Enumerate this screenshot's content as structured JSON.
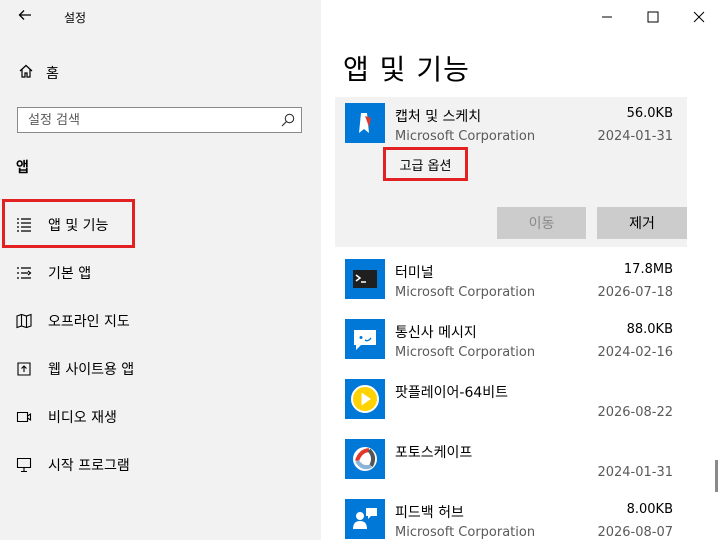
{
  "window": {
    "title": "설정",
    "back_icon": "arrow-left-icon",
    "controls": [
      "minimize-icon",
      "maximize-icon",
      "close-icon"
    ]
  },
  "sidebar": {
    "home_label": "홈",
    "search_placeholder": "설정 검색",
    "section_title": "앱",
    "items": [
      {
        "label": "앱 및 기능",
        "icon": "list-icon",
        "selected": true
      },
      {
        "label": "기본 앱",
        "icon": "default-apps-icon"
      },
      {
        "label": "오프라인 지도",
        "icon": "map-icon"
      },
      {
        "label": "웹 사이트용 앱",
        "icon": "open-in-app-icon"
      },
      {
        "label": "비디오 재생",
        "icon": "video-icon"
      },
      {
        "label": "시작 프로그램",
        "icon": "startup-icon"
      }
    ]
  },
  "main": {
    "title": "앱 및 기능",
    "expanded_app": {
      "name": "캡처 및 스케치",
      "publisher": "Microsoft Corporation",
      "size": "56.0KB",
      "date": "2024-01-31",
      "advanced_options": "고급 옵션",
      "move_label": "이동",
      "uninstall_label": "제거"
    },
    "apps": [
      {
        "name": "터미널",
        "publisher": "Microsoft Corporation",
        "size": "17.8MB",
        "date": "2026-07-18"
      },
      {
        "name": "통신사 메시지",
        "publisher": "Microsoft Corporation",
        "size": "88.0KB",
        "date": "2024-02-16"
      },
      {
        "name": "팟플레이어-64비트",
        "publisher": "",
        "size": "",
        "date": "2026-08-22"
      },
      {
        "name": "포토스케이프",
        "publisher": "",
        "size": "",
        "date": "2024-01-31"
      },
      {
        "name": "피드백 허브",
        "publisher": "Microsoft Corporation",
        "size": "8.00KB",
        "date": "2026-08-07"
      }
    ]
  },
  "colors": {
    "sidebar_bg": "#f2f2f2",
    "highlight_red": "#e22222",
    "accent_blue": "#0078d7",
    "button_gray": "#cccccc"
  }
}
